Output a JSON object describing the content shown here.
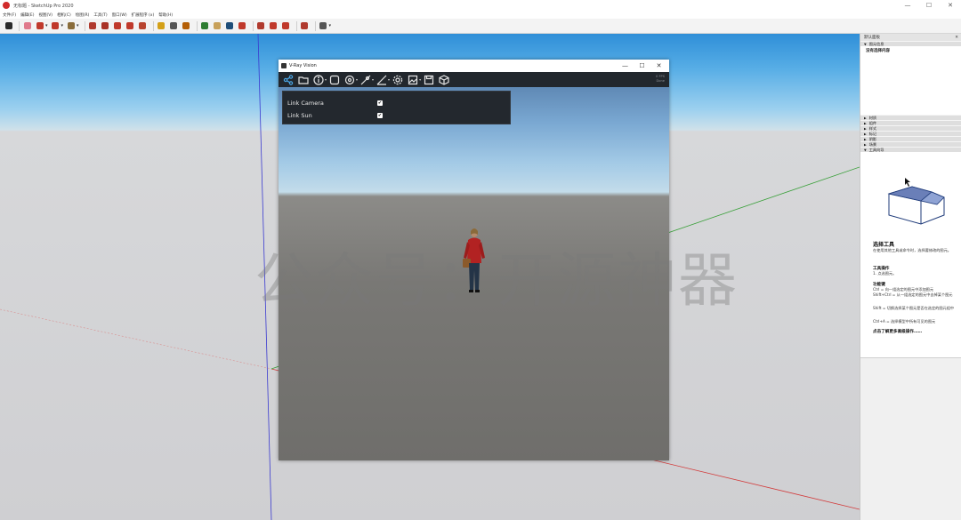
{
  "window": {
    "title": "无标题 - SketchUp Pro 2020",
    "controls": [
      "—",
      "☐",
      "✕"
    ]
  },
  "menu": [
    "文件(F)",
    "编辑(E)",
    "视图(V)",
    "相机(C)",
    "绘图(R)",
    "工具(T)",
    "窗口(W)",
    "扩展程序 (x)",
    "帮助(H)"
  ],
  "toolbar": {
    "buttons": [
      {
        "name": "select-icon",
        "color": "#2a2a2a"
      },
      {
        "name": "eraser-icon",
        "color": "#e07a8c"
      },
      {
        "name": "pencil-icon",
        "color": "#c0392b"
      },
      {
        "name": "arc-icon",
        "color": "#c0392b"
      },
      {
        "name": "rectangle-icon",
        "color": "#8a6d3b"
      },
      {
        "name": "push-pull-icon",
        "color": "#b03a2e"
      },
      {
        "name": "follow-me-icon",
        "color": "#a93226"
      },
      {
        "name": "move-icon",
        "color": "#c0392b"
      },
      {
        "name": "rotate-icon",
        "color": "#c0392b"
      },
      {
        "name": "scale-icon",
        "color": "#b8442f"
      },
      {
        "name": "tape-measure-icon",
        "color": "#d4a017"
      },
      {
        "name": "text-icon",
        "color": "#555"
      },
      {
        "name": "paint-bucket-icon",
        "color": "#b45f06"
      },
      {
        "name": "orbit-icon",
        "color": "#2e7d32"
      },
      {
        "name": "pan-icon",
        "color": "#c8a15a"
      },
      {
        "name": "zoom-icon",
        "color": "#1f4e79"
      },
      {
        "name": "zoom-extents-icon",
        "color": "#c0392b"
      },
      {
        "name": "warehouse-icon",
        "color": "#b03a2e"
      },
      {
        "name": "extension-warehouse-icon",
        "color": "#c0392b"
      },
      {
        "name": "layout-icon",
        "color": "#c0392b"
      },
      {
        "name": "ruby-icon",
        "color": "#b03a2e"
      },
      {
        "name": "account-icon",
        "color": "#555"
      }
    ]
  },
  "vray": {
    "title": "V-Ray Vision",
    "controls": [
      "—",
      "☐",
      "✕"
    ],
    "fps": "0 FPS",
    "fps_sub": "Done",
    "options": [
      {
        "label": "Link Camera",
        "checked": "✔"
      },
      {
        "label": "Link Sun",
        "checked": "✔"
      }
    ]
  },
  "watermark": "公众号：开源神器",
  "panel": {
    "header": "默认面板",
    "close": "✕",
    "entity_info": "图元信息",
    "no_selection": "没有选择内容",
    "sections": [
      "材质",
      "组件",
      "样式",
      "标记",
      "阴影",
      "场景",
      "工具向导"
    ],
    "tool_title": "选择工具",
    "tool_desc": "在使用其他工具或命令时，选择要修改的图元。",
    "ops_title": "工具操作",
    "ops_text": "1. 点选图元。",
    "keys_title": "功能键",
    "keys": [
      "Ctrl = 向一组选定的图元中添加图元",
      "Shift+Ctrl = 从一组选定的图元中去掉某个图元",
      "Shift = 切换选择某个图元是否在选定的图元组中",
      "Ctrl+A = 选择模型中所有可见的图元"
    ],
    "more_link": "点击了解更多高级操作……"
  }
}
